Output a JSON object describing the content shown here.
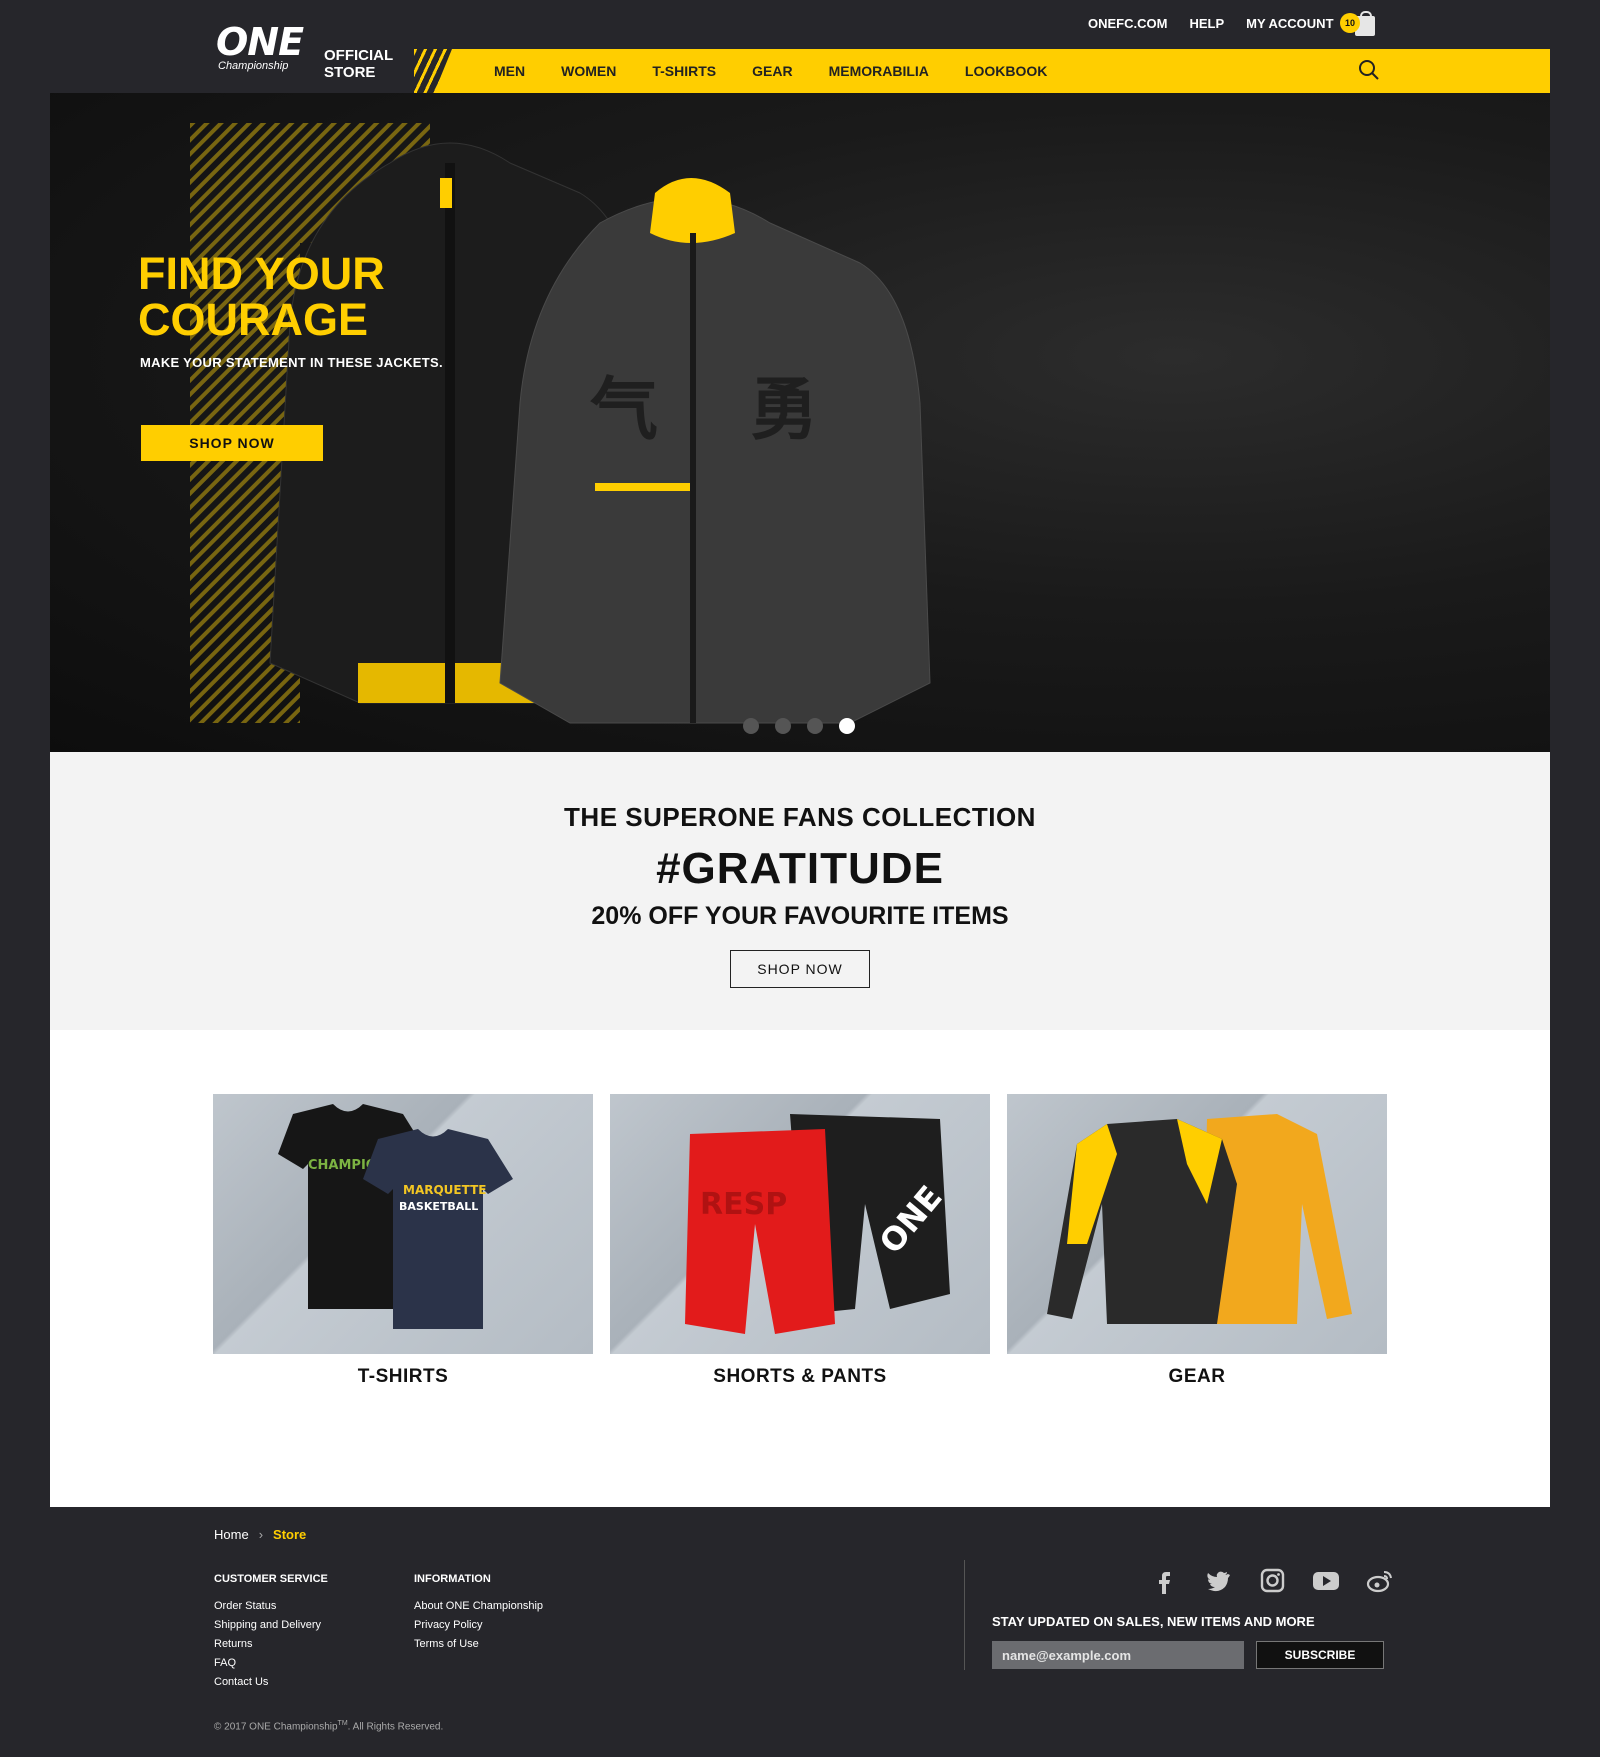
{
  "utility": {
    "links": [
      "ONEFC.COM",
      "HELP",
      "MY ACCOUNT"
    ],
    "cart_count": "10"
  },
  "brand": {
    "logo_text": "ONE",
    "logo_sub": "Championship",
    "store_line1": "OFFICIAL",
    "store_line2": "STORE"
  },
  "nav": {
    "items": [
      "MEN",
      "WOMEN",
      "T-SHIRTS",
      "GEAR",
      "MEMORABILIA",
      "LOOKBOOK"
    ]
  },
  "hero": {
    "title_line1": "FIND YOUR",
    "title_line2": "COURAGE",
    "subtitle": "MAKE YOUR STATEMENT IN THESE JACKETS.",
    "cta": "SHOP NOW",
    "slides": 4,
    "active_slide": 4
  },
  "promo": {
    "line1": "THE SUPERONE FANS COLLECTION",
    "line2": "#GRATITUDE",
    "line3": "20% OFF YOUR FAVOURITE ITEMS",
    "cta": "SHOP NOW"
  },
  "categories": [
    {
      "label": "T-SHIRTS"
    },
    {
      "label": "SHORTS & PANTS"
    },
    {
      "label": "GEAR"
    }
  ],
  "breadcrumb": {
    "home": "Home",
    "current": "Store"
  },
  "footer": {
    "customer_service": {
      "title": "CUSTOMER SERVICE",
      "links": [
        "Order Status",
        "Shipping and Delivery",
        "Returns",
        "FAQ",
        "Contact Us"
      ]
    },
    "information": {
      "title": "INFORMATION",
      "links": [
        "About ONE Championship",
        "Privacy Policy",
        "Terms of Use"
      ]
    },
    "social_icons": [
      "facebook-icon",
      "twitter-icon",
      "instagram-icon",
      "youtube-icon",
      "weibo-icon"
    ],
    "newsletter_title": "STAY UPDATED ON SALES, NEW ITEMS AND MORE",
    "newsletter_placeholder": "name@example.com",
    "subscribe": "SUBSCRIBE",
    "copyright": "© 2017 ONE Championship",
    "copyright_tm": "TM",
    "copyright_rest": ". All Rights Reserved."
  },
  "colors": {
    "accent": "#ffce00",
    "page_bg": "#26262b",
    "promo_bg": "#f3f3f3"
  }
}
